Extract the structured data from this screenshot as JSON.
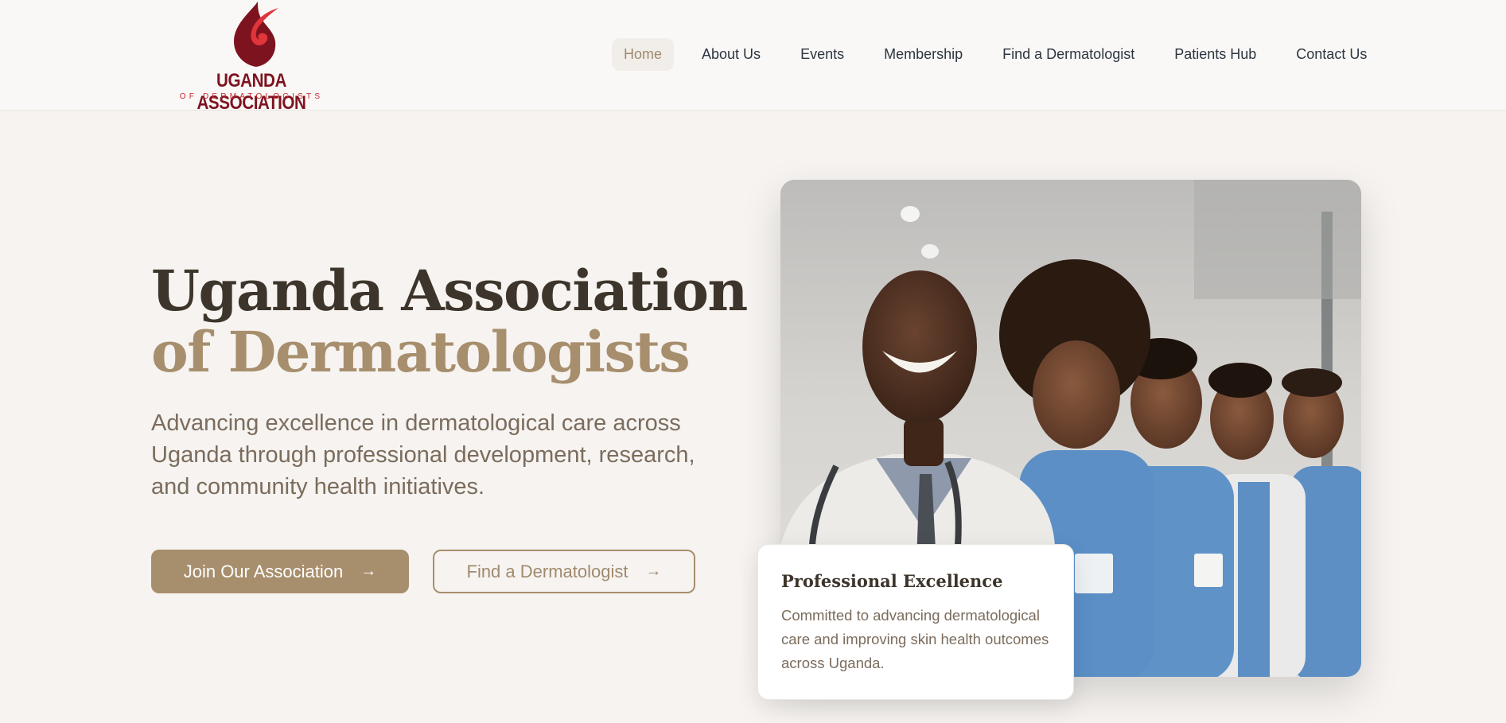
{
  "brand": {
    "logo_title": "UGANDA ASSOCIATION",
    "logo_subtitle": "OF DERMATOLOGISTS",
    "colors": {
      "dark_red": "#7e1320",
      "red": "#c4252e",
      "accent": "#a78e6d"
    }
  },
  "nav": {
    "items": [
      {
        "label": "Home",
        "active": true
      },
      {
        "label": "About Us"
      },
      {
        "label": "Events"
      },
      {
        "label": "Membership"
      },
      {
        "label": "Find a Dermatologist"
      },
      {
        "label": "Patients Hub"
      },
      {
        "label": "Contact Us"
      }
    ]
  },
  "hero": {
    "title_line1": "Uganda Association",
    "title_line2": "of Dermatologists",
    "description": "Advancing excellence in dermatological care across Uganda through professional development, research, and community health initiatives.",
    "primary_button": "Join Our Association",
    "secondary_button": "Find a Dermatologist",
    "arrow_icon": "arrow-right-icon"
  },
  "card": {
    "title": "Professional Excellence",
    "text": "Committed to advancing dermatological care and improving skin health outcomes across Uganda."
  }
}
